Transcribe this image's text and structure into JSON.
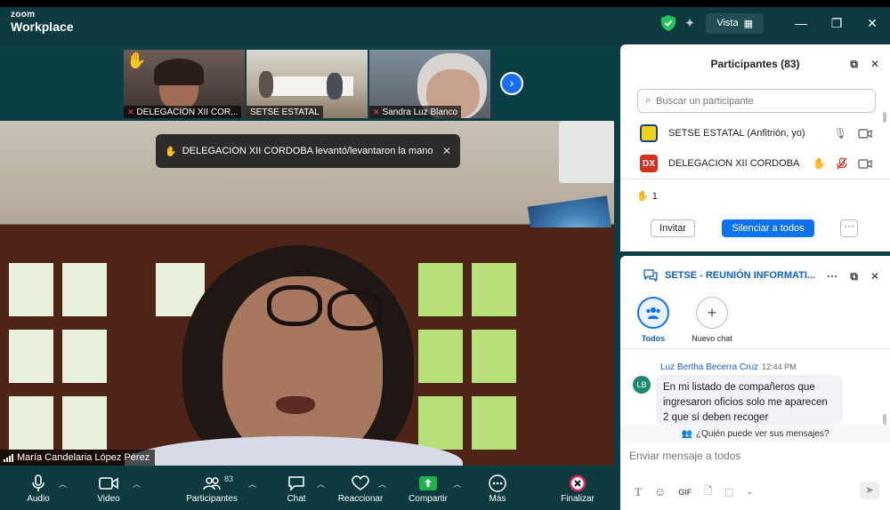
{
  "app": {
    "brand_small": "zoom",
    "brand_large": "Workplace",
    "view_label": "Vista"
  },
  "thumbnails": [
    {
      "label": "DELEGACION XII COR...",
      "muted": true
    },
    {
      "label": "SETSE ESTATAL",
      "muted": false
    },
    {
      "label": "Sandra Luz Blanco",
      "muted": true
    }
  ],
  "notification": {
    "text": "DELEGACION XII CORDOBA levantó/levantaron la mano"
  },
  "speaker": {
    "name": "María Candelaria López Pérez"
  },
  "toolbar": {
    "audio": "Audio",
    "video": "Video",
    "participants": "Participantes",
    "participants_count": "83",
    "chat": "Chat",
    "react": "Reaccionar",
    "share": "Compartir",
    "more": "Más",
    "end": "Finalizar"
  },
  "participants_panel": {
    "title": "Participantes (83)",
    "search_placeholder": "Buscar un participante",
    "rows": [
      {
        "avatar": "",
        "name": "SETSE ESTATAL (Anfitrión, yo)"
      },
      {
        "avatar": "DX",
        "name": "DELEGACION XII CORDOBA"
      }
    ],
    "raised_hands": "1",
    "invite": "Invitar",
    "mute_all": "Silenciar a todos",
    "more": "···"
  },
  "chat_panel": {
    "title": "SETSE - REUNIÓN INFORMATI...",
    "tab_all": "Todos",
    "tab_new": "Nuevo chat",
    "message": {
      "initials": "LB",
      "sender": "Luz Bertha Becerra Cruz",
      "time": "12:44 PM",
      "text": "En mi listado de compañeros que ingresaron oficios solo me aparecen 2 que sí deben recoger"
    },
    "who_can_see": "¿Quién puede ver sus mensajes?",
    "input_placeholder": "Enviar mensaje a todos",
    "gif_label": "GIF"
  },
  "colors": {
    "accent": "#0e72ed",
    "bar": "#0c3a40",
    "share_green": "#21b14a",
    "end_red": "#e0245e"
  }
}
